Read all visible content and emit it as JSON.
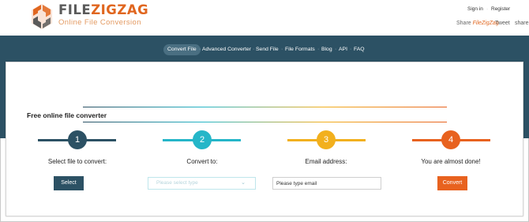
{
  "brand": {
    "name_part1": "FILE",
    "name_part2": "ZIGZAG",
    "tagline": "Online File Conversion"
  },
  "top_links": {
    "signin": "Sign in",
    "separator": "·",
    "register": "Register"
  },
  "share": {
    "label": "Share ",
    "brand": "FileZigZag",
    "tweet": "Tweet",
    "share": "share"
  },
  "nav": {
    "items": [
      "Convert File",
      "Advanced Converter",
      "Send File",
      "File Formats",
      "Blog",
      "API",
      "FAQ"
    ],
    "separator": "·"
  },
  "main": {
    "title": "Free online file converter",
    "steps": [
      {
        "number": "1",
        "label": "Select file to convert:",
        "color": "#2c5164"
      },
      {
        "number": "2",
        "label": "Convert to:",
        "color": "#25b6c8"
      },
      {
        "number": "3",
        "label": "Email address:",
        "color": "#f2b01e"
      },
      {
        "number": "4",
        "label": "You are almost done!",
        "color": "#e8621f"
      }
    ],
    "select_button": "Select",
    "format_placeholder": "Please select type",
    "email_placeholder": "Please type email",
    "convert_button": "Convert"
  },
  "colors": {
    "accent": "#e0661f",
    "band": "#2c5164"
  },
  "icons": {
    "logo": "filezigzag-logo-icon",
    "dropdown": "chevron-down-icon"
  }
}
